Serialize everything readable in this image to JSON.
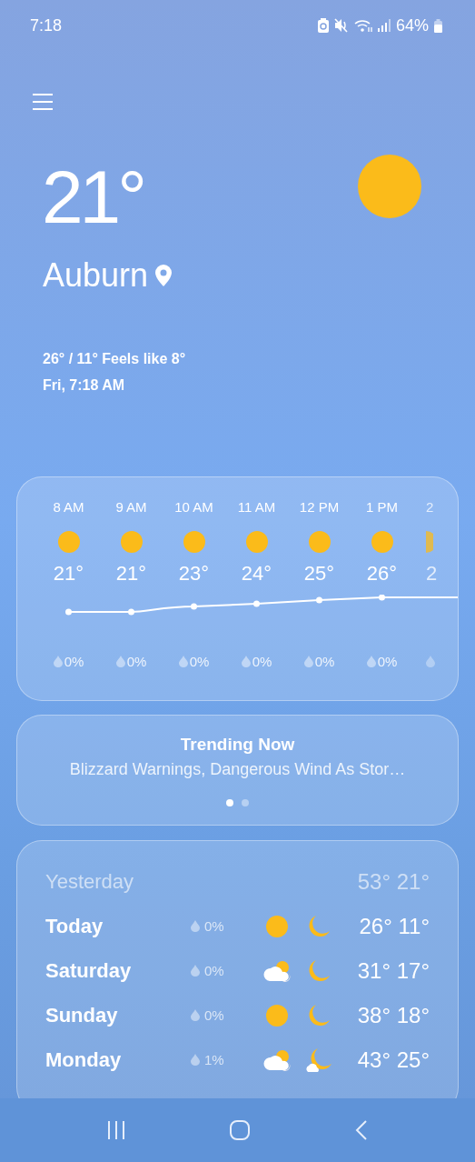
{
  "status_bar": {
    "time": "7:18",
    "battery": "64%"
  },
  "current": {
    "temperature": "21°",
    "location": "Auburn",
    "range": "26° / 11° Feels like 8°",
    "updated": "Fri, 7:18 AM"
  },
  "hourly": [
    {
      "time": "8 AM",
      "temp": "21°",
      "precip": "0%",
      "cut": false
    },
    {
      "time": "9 AM",
      "temp": "21°",
      "precip": "0%",
      "cut": false
    },
    {
      "time": "10 AM",
      "temp": "23°",
      "precip": "0%",
      "cut": false
    },
    {
      "time": "11 AM",
      "temp": "24°",
      "precip": "0%",
      "cut": false
    },
    {
      "time": "12 PM",
      "temp": "25°",
      "precip": "0%",
      "cut": false
    },
    {
      "time": "1 PM",
      "temp": "26°",
      "precip": "0%",
      "cut": false
    },
    {
      "time": "2",
      "temp": "2",
      "cut": true
    }
  ],
  "trending": {
    "title": "Trending Now",
    "headline": "Blizzard Warnings, Dangerous Wind As Stor…",
    "pages": [
      {
        "selected": true
      },
      {
        "selected": false
      }
    ]
  },
  "daily": [
    {
      "day": "Yesterday",
      "high": "53°",
      "low": "21°",
      "past": true
    },
    {
      "day": "Today",
      "precip": "0%",
      "day_icon": {
        "kind": "sun"
      },
      "night_icon": {
        "kind": "moon"
      },
      "high": "26°",
      "low": "11°",
      "past": false
    },
    {
      "day": "Saturday",
      "precip": "0%",
      "day_icon": {
        "kind": "partly-cloudy"
      },
      "night_icon": {
        "kind": "moon"
      },
      "high": "31°",
      "low": "17°",
      "past": false
    },
    {
      "day": "Sunday",
      "precip": "0%",
      "day_icon": {
        "kind": "sun"
      },
      "night_icon": {
        "kind": "moon"
      },
      "high": "38°",
      "low": "18°",
      "past": false
    },
    {
      "day": "Monday",
      "precip": "1%",
      "day_icon": {
        "kind": "partly-cloudy"
      },
      "night_icon": {
        "kind": "moon-cloud"
      },
      "high": "43°",
      "low": "25°",
      "past": false
    }
  ]
}
